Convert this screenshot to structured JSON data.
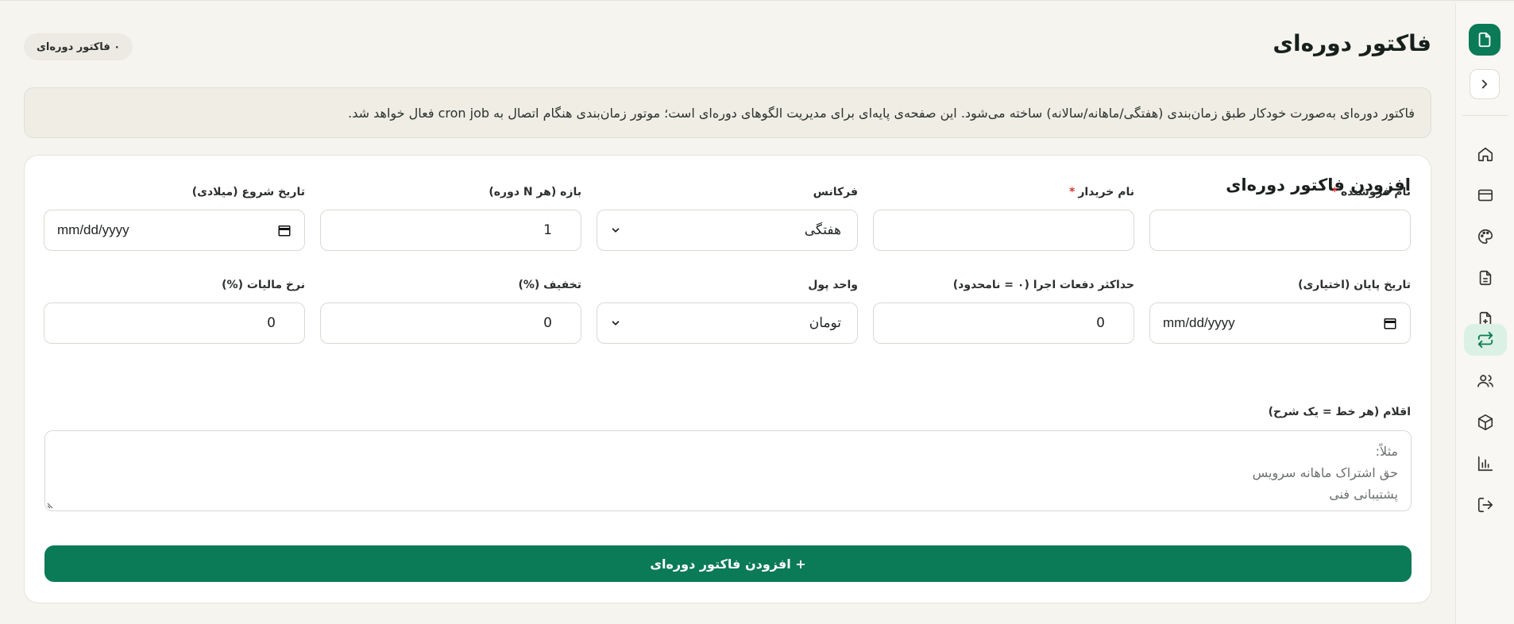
{
  "header": {
    "title": "فاکتور دوره‌ای",
    "count_badge": "۰ فاکتور دوره‌ای"
  },
  "info_banner": "فاکتور دوره‌ای به‌صورت خودکار طبق زمان‌بندی (هفتگی/ماهانه/سالانه) ساخته می‌شود. این صفحه‌ی پایه‌ای برای مدیریت الگوهای دوره‌ای است؛ موتور زمان‌بندی هنگام اتصال به cron job فعال خواهد شد.",
  "form": {
    "title": "افزودن فاکتور دوره‌ای",
    "seller": {
      "label": "نام فروشنده",
      "required_mark": "*",
      "value": ""
    },
    "buyer": {
      "label": "نام خریدار",
      "required_mark": "*",
      "value": ""
    },
    "frequency": {
      "label": "فرکانس",
      "value": "هفتگی"
    },
    "interval": {
      "label": "بازه (هر N دوره)",
      "value": "1"
    },
    "start_date": {
      "label": "تاریخ شروع (میلادی)",
      "placeholder": "mm/dd/yyyy"
    },
    "end_date": {
      "label": "تاریخ پایان (اختیاری)",
      "placeholder": "mm/dd/yyyy"
    },
    "max_runs": {
      "label": "حداکثر دفعات اجرا (۰ = نامحدود)",
      "value": "0"
    },
    "currency": {
      "label": "واحد پول",
      "value": "تومان"
    },
    "discount": {
      "label": "تخفیف (%)",
      "value": "0"
    },
    "tax_rate": {
      "label": "نرخ مالیات (%)",
      "value": "0"
    },
    "items": {
      "label": "اقلام (هر خط = یک شرح)",
      "placeholder_lines": [
        "مثلاً:",
        "حق اشتراک ماهانه سرویس",
        "پشتیبانی فنی"
      ]
    },
    "submit_label": "+ افزودن فاکتور دوره‌ای"
  },
  "sidebar": {
    "icons": [
      "document-icon",
      "chevron-right-icon",
      "home-icon",
      "card-icon",
      "palette-icon",
      "file-text-icon",
      "file-plus-icon",
      "repeat-icon",
      "users-icon",
      "package-icon",
      "bar-chart-icon",
      "logout-icon"
    ]
  },
  "colors": {
    "accent": "#0a7a57",
    "background": "#f5f4ef",
    "active_bg": "#dcf1e6",
    "required": "#d63434"
  }
}
